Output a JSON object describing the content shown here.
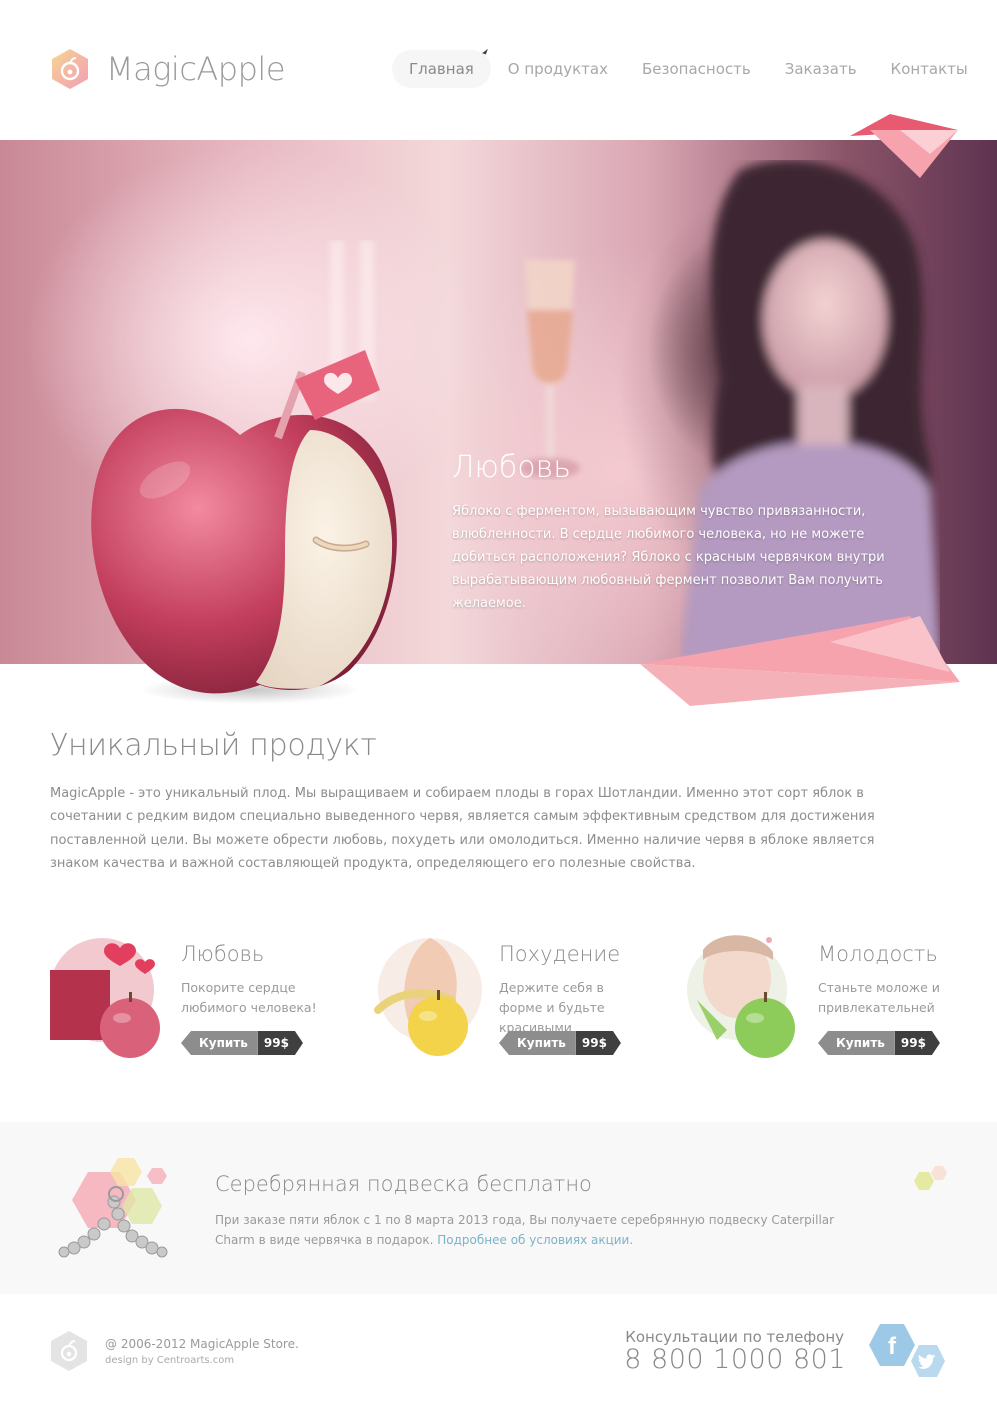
{
  "brand": {
    "name": "MagicApple"
  },
  "nav": {
    "items": [
      {
        "label": "Главная",
        "active": true
      },
      {
        "label": "О продуктах"
      },
      {
        "label": "Безопасность"
      },
      {
        "label": "Заказать"
      },
      {
        "label": "Контакты"
      }
    ]
  },
  "hero": {
    "title": "Любовь",
    "text": "Яблоко с ферментом, вызывающим чувство привязанности, влюбленности. В сердце любимого человека, но не можете добиться расположения? Яблоко с красным червячком внутри вырабатывающим любовный фермент позволит Вам получить желаемое."
  },
  "unique": {
    "title": "Уникальный продукт",
    "text": "MagicApple - это уникальный плод. Мы выращиваем и собираем плоды в горах Шотландии. Именно этот сорт яблок в сочетании с редким видом специально выведенного червя, является самым эффективным средством для достижения поставленной цели. Вы можете обрести любовь, похудеть или омолодиться. Именно наличие червя в яблоке является знаком качества и важной составляющей продукта, определяющего его полезные свойства."
  },
  "products": [
    {
      "name": "Любовь",
      "desc": "Покорите сердце любимого человека!",
      "buy_label": "Купить",
      "price": "99$",
      "apple_color": "#d9627a"
    },
    {
      "name": "Похудение",
      "desc": "Держите себя в форме и будьте красивыми",
      "buy_label": "Купить",
      "price": "99$",
      "apple_color": "#f2d34a"
    },
    {
      "name": "Молодость",
      "desc": "Станьте моложе и привлекательней",
      "buy_label": "Купить",
      "price": "99$",
      "apple_color": "#8dcc5a"
    }
  ],
  "promo": {
    "title": "Серебрянная подвеска бесплатно",
    "text": "При заказе пяти яблок с 1 по 8 марта 2013 года, Вы получаете серебрянную подвеску Caterpillar Charm в виде червячка в подарок. ",
    "link": "Подробнее об условиях акции."
  },
  "footer": {
    "copyright": "@ 2006-2012 MagicApple Store.",
    "design": "design by Centroarts.com",
    "consult": "Консультации по телефону",
    "phone": "8 800 1000 801"
  },
  "social": {
    "facebook": "f",
    "twitter": "twitter-icon"
  }
}
